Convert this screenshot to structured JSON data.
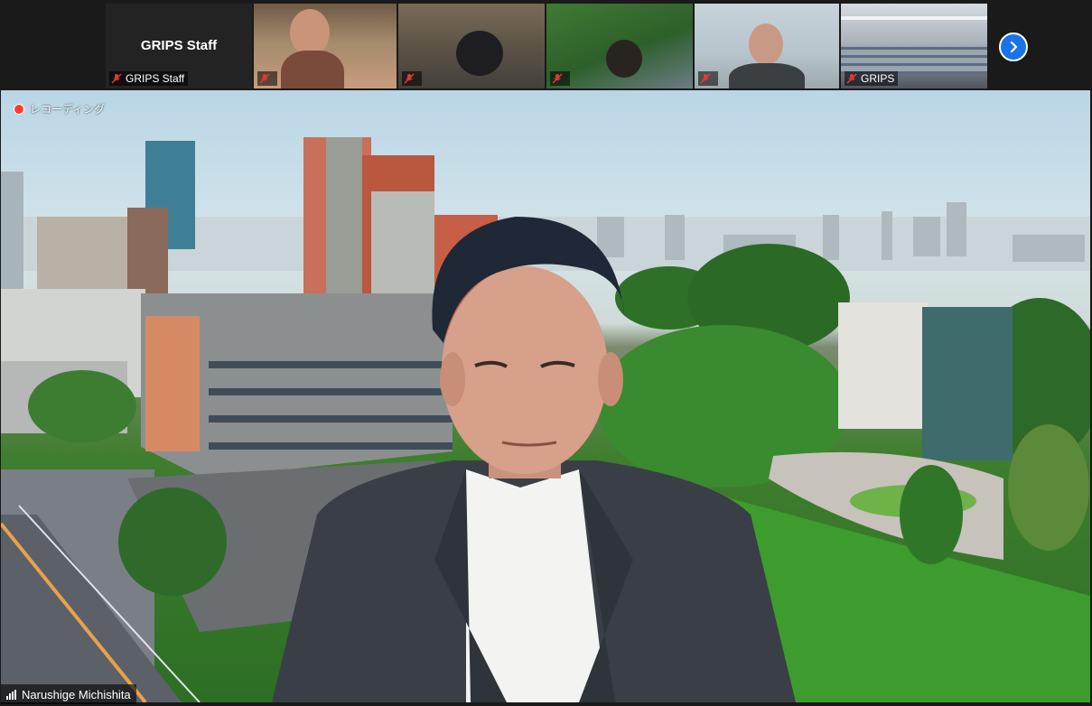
{
  "gallery": {
    "staff_tile": {
      "name": "GRIPS Staff",
      "label": "GRIPS Staff"
    },
    "video_tiles": [
      {
        "label": ""
      },
      {
        "label": ""
      },
      {
        "label": ""
      },
      {
        "label": ""
      },
      {
        "label": "GRIPS"
      }
    ],
    "next_page_icon": "chevron-right-icon"
  },
  "main_video": {
    "recording_label": "レコーディング",
    "speaker_name": "Narushige Michishita"
  },
  "colors": {
    "recording": "#ff3b30",
    "mute": "#e53935",
    "accent": "#1a73e8"
  }
}
